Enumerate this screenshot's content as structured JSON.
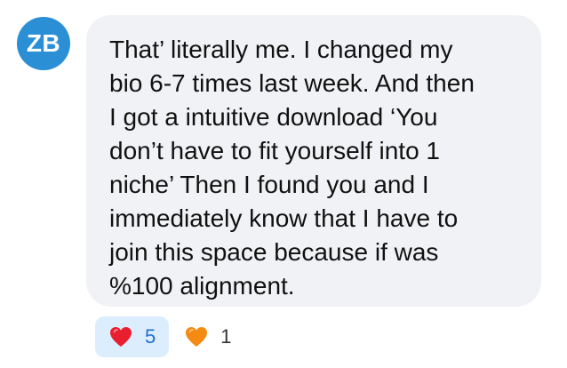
{
  "author": {
    "initials": "ZB",
    "avatar_color": "#2b8fd6"
  },
  "message": {
    "text": "That’ literally me. I changed my\nbio 6-7 times last week. And then\nI got a intuitive download ‘You\ndon’t have to fit yourself into 1\nniche’ Then I found you and I\nimmediately know that I have to\njoin this space because if was\n%100 alignment."
  },
  "reactions": [
    {
      "icon": "red-heart-icon",
      "color": "#e8202e",
      "count": "5",
      "selected": true
    },
    {
      "icon": "orange-heart-icon",
      "color": "#f58a12",
      "count": "1",
      "selected": false
    }
  ],
  "colors": {
    "bubble_bg": "#f1f2f5",
    "selected_reaction_bg": "#dceefe",
    "selected_count": "#1e6fd0"
  }
}
